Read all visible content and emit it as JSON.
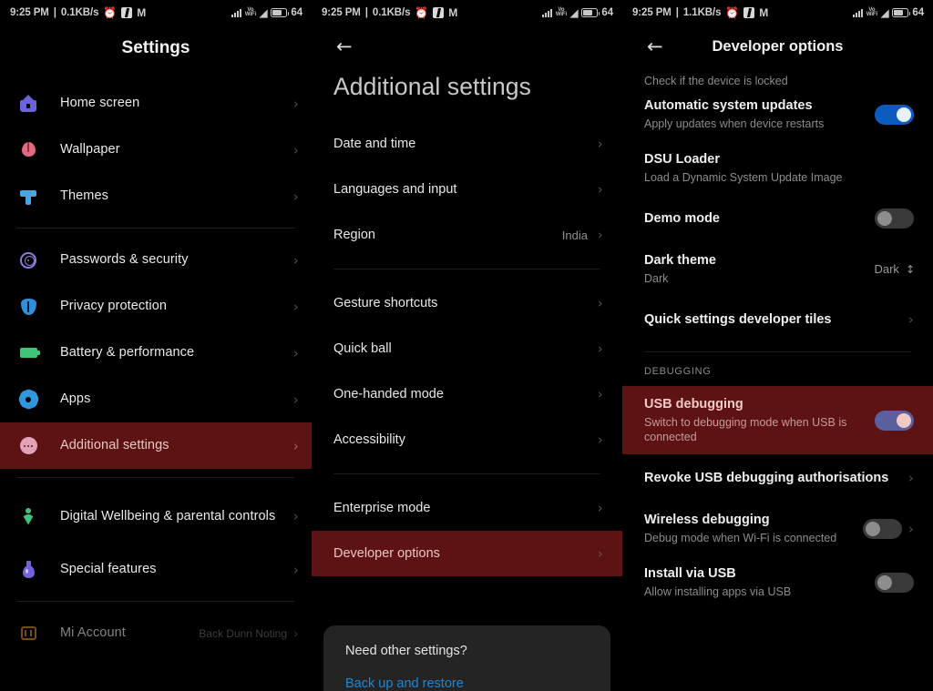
{
  "statusbars": [
    {
      "time": "9:25 PM",
      "sep": "|",
      "speed": "0.1KB/s",
      "battery": "64",
      "pct": "%"
    },
    {
      "time": "9:25 PM",
      "sep": "|",
      "speed": "0.1KB/s",
      "battery": "64",
      "pct": "%"
    },
    {
      "time": "9:25 PM",
      "sep": "|",
      "speed": "1.1KB/s",
      "battery": "64",
      "pct": "%"
    }
  ],
  "panel1": {
    "title": "Settings",
    "group_a": [
      {
        "label": "Home screen",
        "icon": "home-icon"
      },
      {
        "label": "Wallpaper",
        "icon": "flower-icon"
      },
      {
        "label": "Themes",
        "icon": "paintbrush-icon"
      }
    ],
    "group_b": [
      {
        "label": "Passwords & security",
        "icon": "fingerprint-icon"
      },
      {
        "label": "Privacy protection",
        "icon": "shield-icon"
      },
      {
        "label": "Battery & performance",
        "icon": "battery-icon"
      },
      {
        "label": "Apps",
        "icon": "gear-icon"
      },
      {
        "label": "Additional settings",
        "icon": "dots-circle-icon",
        "selected": true
      }
    ],
    "group_c": [
      {
        "label": "Digital Wellbeing & parental controls",
        "icon": "heart-person-icon"
      },
      {
        "label": "Special features",
        "icon": "potion-icon"
      }
    ],
    "group_d": [
      {
        "label": "Mi Account",
        "icon": "mi-logo-icon",
        "value": "Back Dunn Noting"
      }
    ]
  },
  "panel2": {
    "back": "back-arrow",
    "title": "Additional settings",
    "group_a": [
      {
        "label": "Date and time"
      },
      {
        "label": "Languages and input"
      },
      {
        "label": "Region",
        "value": "India"
      }
    ],
    "group_b": [
      {
        "label": "Gesture shortcuts"
      },
      {
        "label": "Quick ball"
      },
      {
        "label": "One-handed mode"
      },
      {
        "label": "Accessibility"
      }
    ],
    "group_c": [
      {
        "label": "Enterprise mode"
      },
      {
        "label": "Developer options",
        "selected": true
      }
    ],
    "card": {
      "title": "Need other settings?",
      "link": "Back up and restore"
    }
  },
  "panel3": {
    "back": "back-arrow",
    "title": "Developer options",
    "top_partial": "Check if the device is locked",
    "rows": [
      {
        "title": "Automatic system updates",
        "subtitle": "Apply updates when device restarts",
        "control": "toggle",
        "state": "on"
      },
      {
        "title": "DSU Loader",
        "subtitle": "Load a Dynamic System Update Image",
        "control": "none"
      },
      {
        "title": "Demo mode",
        "subtitle": "",
        "control": "toggle",
        "state": "off"
      },
      {
        "title": "Dark theme",
        "subtitle": "Dark",
        "control": "select",
        "value": "Dark"
      },
      {
        "title": "Quick settings developer tiles",
        "subtitle": "",
        "control": "chevron"
      }
    ],
    "section_debugging": "DEBUGGING",
    "debug_rows": [
      {
        "title": "USB debugging",
        "subtitle": "Switch to debugging mode when USB is connected",
        "control": "toggle",
        "state": "on",
        "selected": true
      },
      {
        "title": "Revoke USB debugging authorisations",
        "subtitle": "",
        "control": "chevron"
      },
      {
        "title": "Wireless debugging",
        "subtitle": "Debug mode when Wi-Fi is connected",
        "control": "toggle-chevron",
        "state": "off"
      },
      {
        "title": "Install via USB",
        "subtitle": "Allow installing apps via USB",
        "control": "toggle",
        "state": "off"
      }
    ]
  },
  "colors": {
    "selected_row": "#5d1314",
    "toggle_on": "#0c5cbf",
    "link": "#1a87d8",
    "battery_icon": "#3fc47a"
  }
}
